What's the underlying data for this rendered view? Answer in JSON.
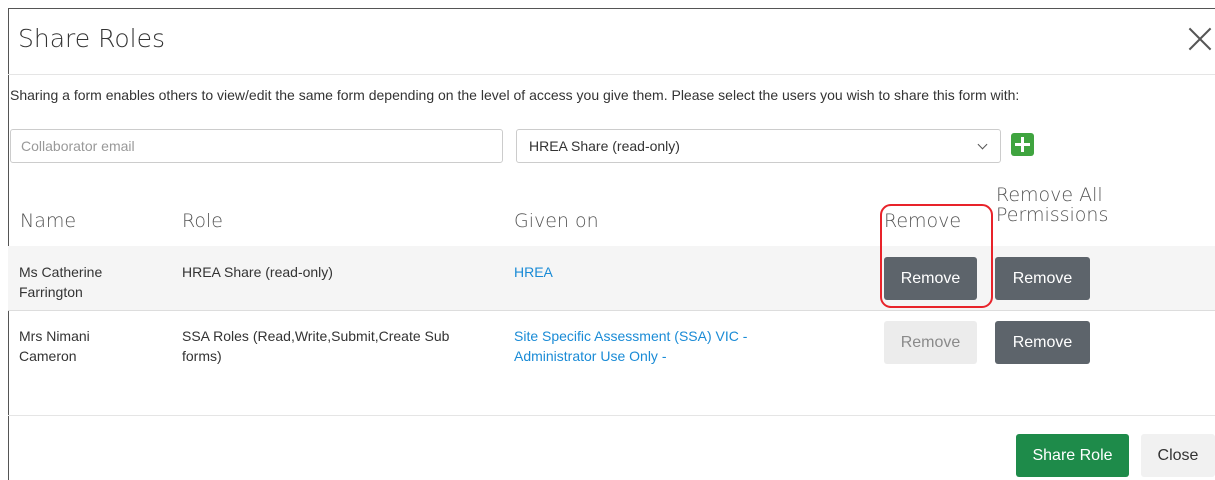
{
  "modal": {
    "title": "Share Roles",
    "intro": "Sharing a form enables others to view/edit the same form depending on the level of access you give them. Please select the users you wish to share this form with:",
    "email_placeholder": "Collaborator email",
    "role_selected": "HREA Share (read-only)"
  },
  "table": {
    "headers": {
      "name": "Name",
      "role": "Role",
      "given_on": "Given on",
      "remove": "Remove",
      "remove_all_line1": "Remove All",
      "remove_all_line2": "Permissions"
    },
    "rows": [
      {
        "name_line1": "Ms Catherine",
        "name_line2": "Farrington",
        "role_line1": "HREA Share (read-only)",
        "role_line2": "",
        "given_line1": "HREA",
        "given_line2": "",
        "remove_label": "Remove",
        "remove_enabled": true,
        "remove_all_label": "Remove"
      },
      {
        "name_line1": "Mrs Nimani",
        "name_line2": "Cameron",
        "role_line1": "SSA Roles (Read,Write,Submit,Create Sub",
        "role_line2": "forms)",
        "given_line1": "Site Specific Assessment (SSA) VIC -",
        "given_line2": "Administrator Use Only -",
        "remove_label": "Remove",
        "remove_enabled": false,
        "remove_all_label": "Remove"
      }
    ]
  },
  "footer": {
    "share_label": "Share Role",
    "close_label": "Close"
  },
  "colors": {
    "link": "#1a8bd6",
    "primary_green": "#1e8b4a",
    "add_green": "#3fa43f",
    "dark_button": "#5d646b",
    "highlight_red": "#e8232a"
  },
  "icons": {
    "close": "close-icon",
    "add": "plus-icon",
    "dropdown": "chevron-down-icon"
  }
}
